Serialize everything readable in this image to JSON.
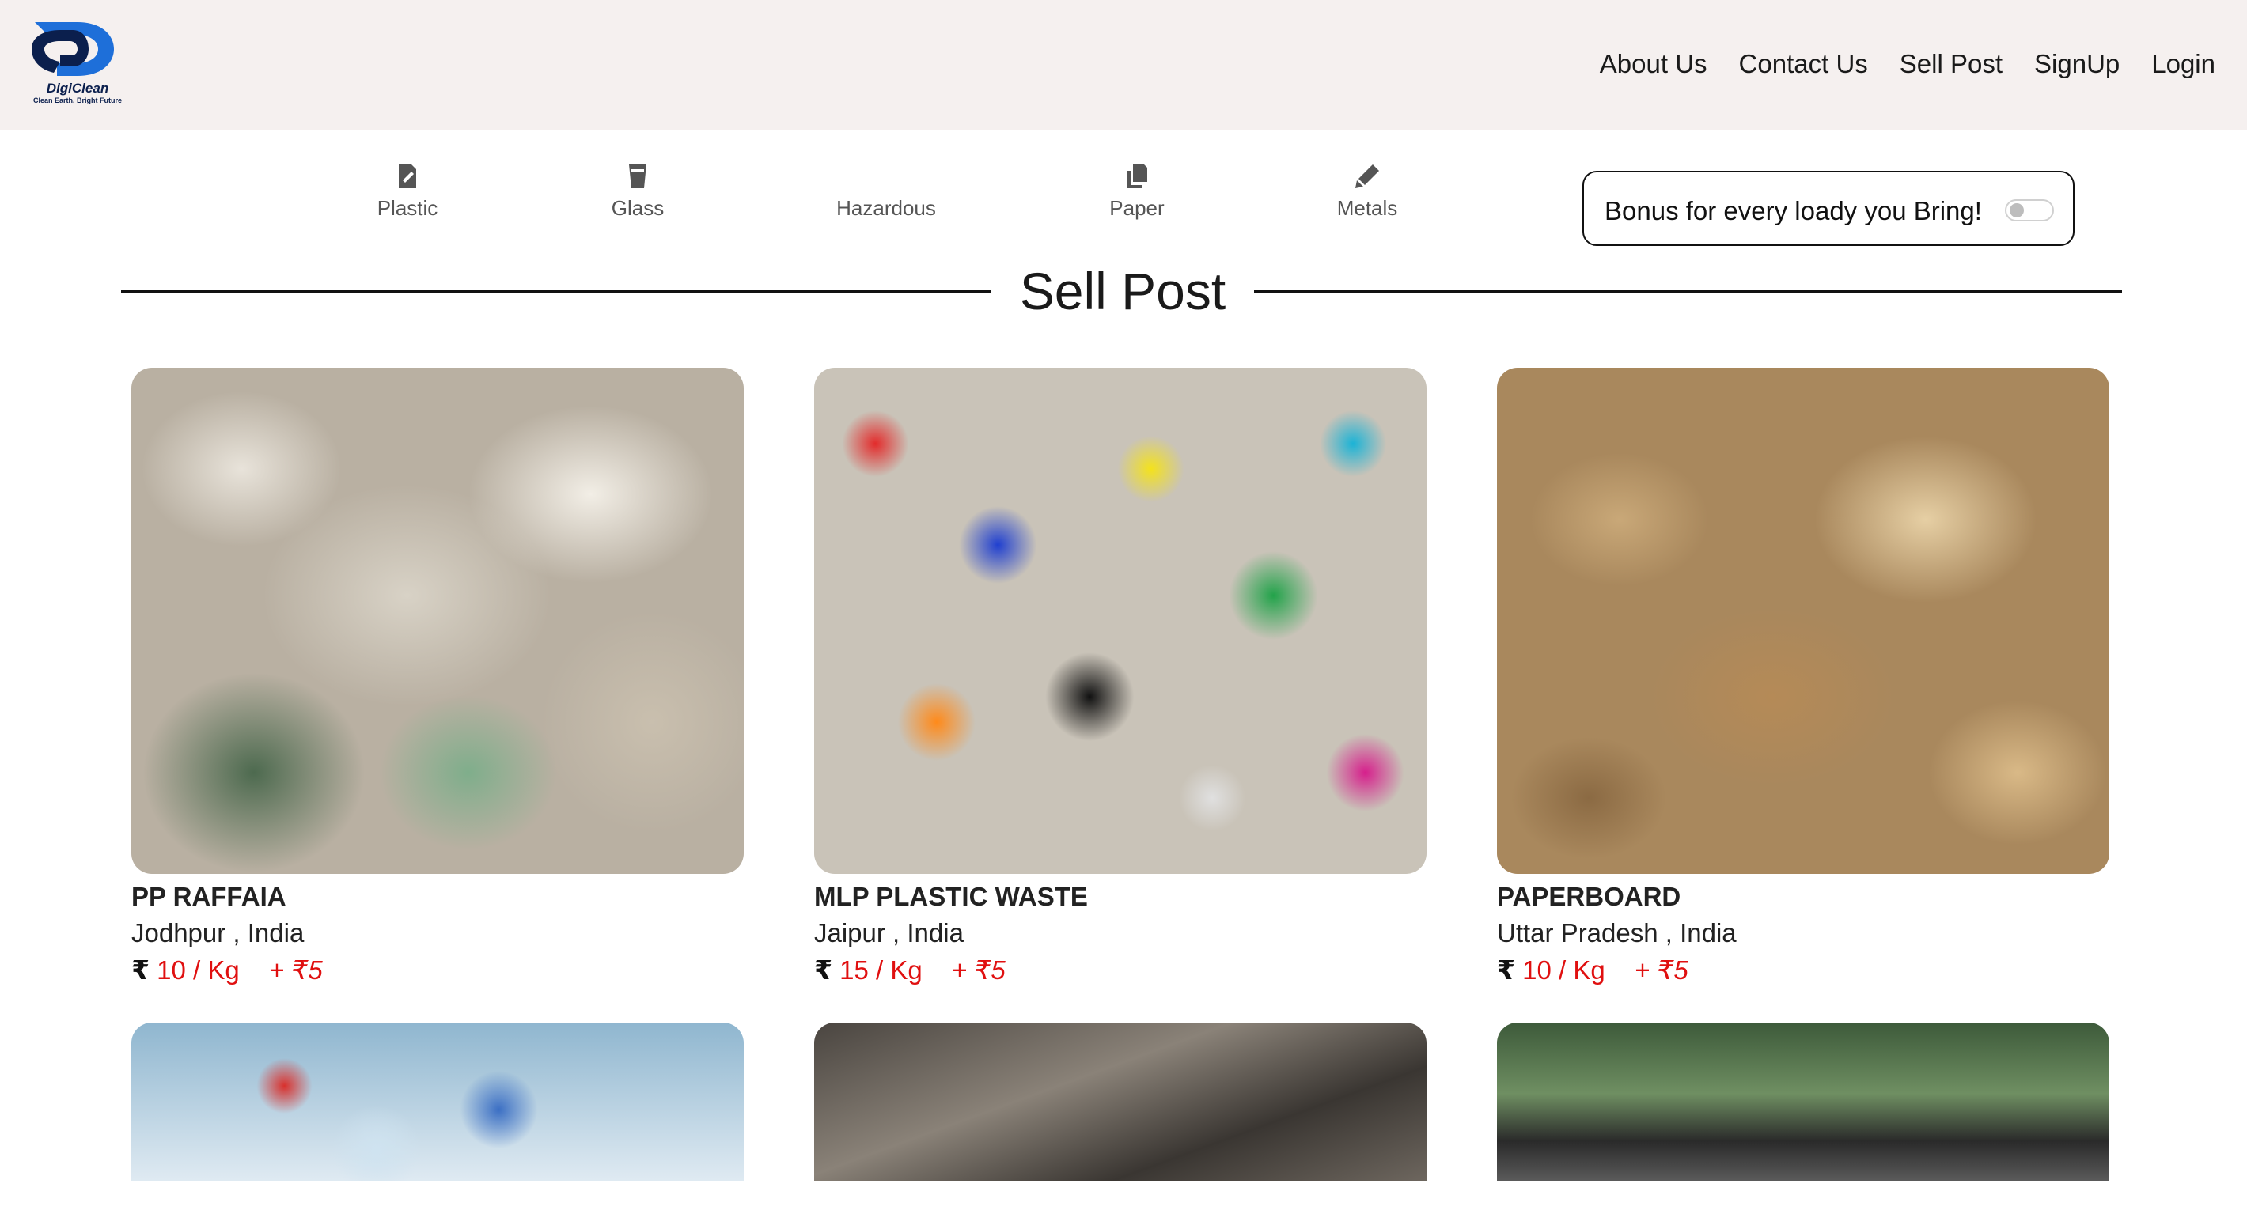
{
  "header": {
    "logo": {
      "name": "DigiClean",
      "tagline": "Clean Earth, Bright Future"
    },
    "nav": [
      "About Us",
      "Contact Us",
      "Sell Post",
      "SignUp",
      "Login"
    ]
  },
  "categories": [
    {
      "label": "Plastic",
      "icon": "plastic-icon"
    },
    {
      "label": "Glass",
      "icon": "glass-icon"
    },
    {
      "label": "Hazardous",
      "icon": ""
    },
    {
      "label": "Paper",
      "icon": "paper-icon"
    },
    {
      "label": "Metals",
      "icon": "metals-icon"
    }
  ],
  "bonus": {
    "label": "Bonus for every loady you Bring!",
    "enabled": false
  },
  "page_title": "Sell Post",
  "listings": [
    {
      "name": "PP RAFFAIA",
      "location": "Jodhpur , India",
      "currency": "₹",
      "price": "10 / Kg",
      "bonus": "+ ₹5"
    },
    {
      "name": "MLP PLASTIC WASTE",
      "location": "Jaipur , India",
      "currency": "₹",
      "price": "15 / Kg",
      "bonus": "+ ₹5"
    },
    {
      "name": "PAPERBOARD",
      "location": "Uttar Pradesh , India",
      "currency": "₹",
      "price": "10 / Kg",
      "bonus": "+ ₹5"
    },
    {
      "name": "",
      "location": "",
      "currency": "",
      "price": "",
      "bonus": ""
    },
    {
      "name": "",
      "location": "",
      "currency": "",
      "price": "",
      "bonus": ""
    },
    {
      "name": "",
      "location": "",
      "currency": "",
      "price": "",
      "bonus": ""
    }
  ],
  "colors": {
    "header_bg": "#f5f0ef",
    "price": "#e01010",
    "logo": "#1e6fd9"
  }
}
